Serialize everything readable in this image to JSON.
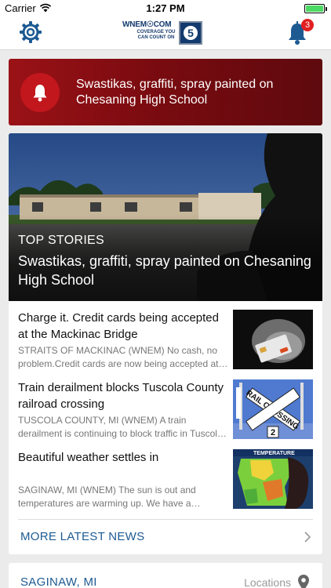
{
  "status_bar": {
    "carrier": "Carrier",
    "time": "1:27 PM"
  },
  "nav": {
    "logo": {
      "name": "WNEM☉COM",
      "tagline": "COVERAGE YOU CAN COUNT ON",
      "channel": "5"
    },
    "notification_count": "3"
  },
  "alert": {
    "text": "Swastikas, graffiti, spray painted on Chesaning High School"
  },
  "top_story": {
    "kicker": "TOP STORIES",
    "title": "Swastikas, graffiti, spray painted on Chesaning High School"
  },
  "stories": [
    {
      "title": "Charge it. Credit cards being accepted at the Mackinac Bridge",
      "summary": "STRAITS OF MACKINAC (WNEM) No cash, no problem.Credit cards are now being accepted at the Mackinac Bridge."
    },
    {
      "title": "Train derailment blocks Tuscola County railroad crossing",
      "summary": "TUSCOLA COUNTY, MI (WNEM) A train derailment is continuing to block traffic in Tuscola County."
    },
    {
      "title": "Beautiful weather settles in",
      "summary": "SAGINAW, MI (WNEM) The sun is out and temperatures are warming up. We have a gorgeous stretch of weather on tap for the next few days."
    }
  ],
  "thumb_text": {
    "crossing_sign": "RAIL CROSSING",
    "crossing_number": "2",
    "temperature_banner": "TEMPERATURE"
  },
  "more_news": {
    "label": "MORE LATEST NEWS"
  },
  "weather": {
    "city": "SAGINAW, MI",
    "locations_label": "Locations"
  },
  "colors": {
    "accent": "#1d5a92",
    "alert": "#8b0f14",
    "badge": "#e02020"
  }
}
